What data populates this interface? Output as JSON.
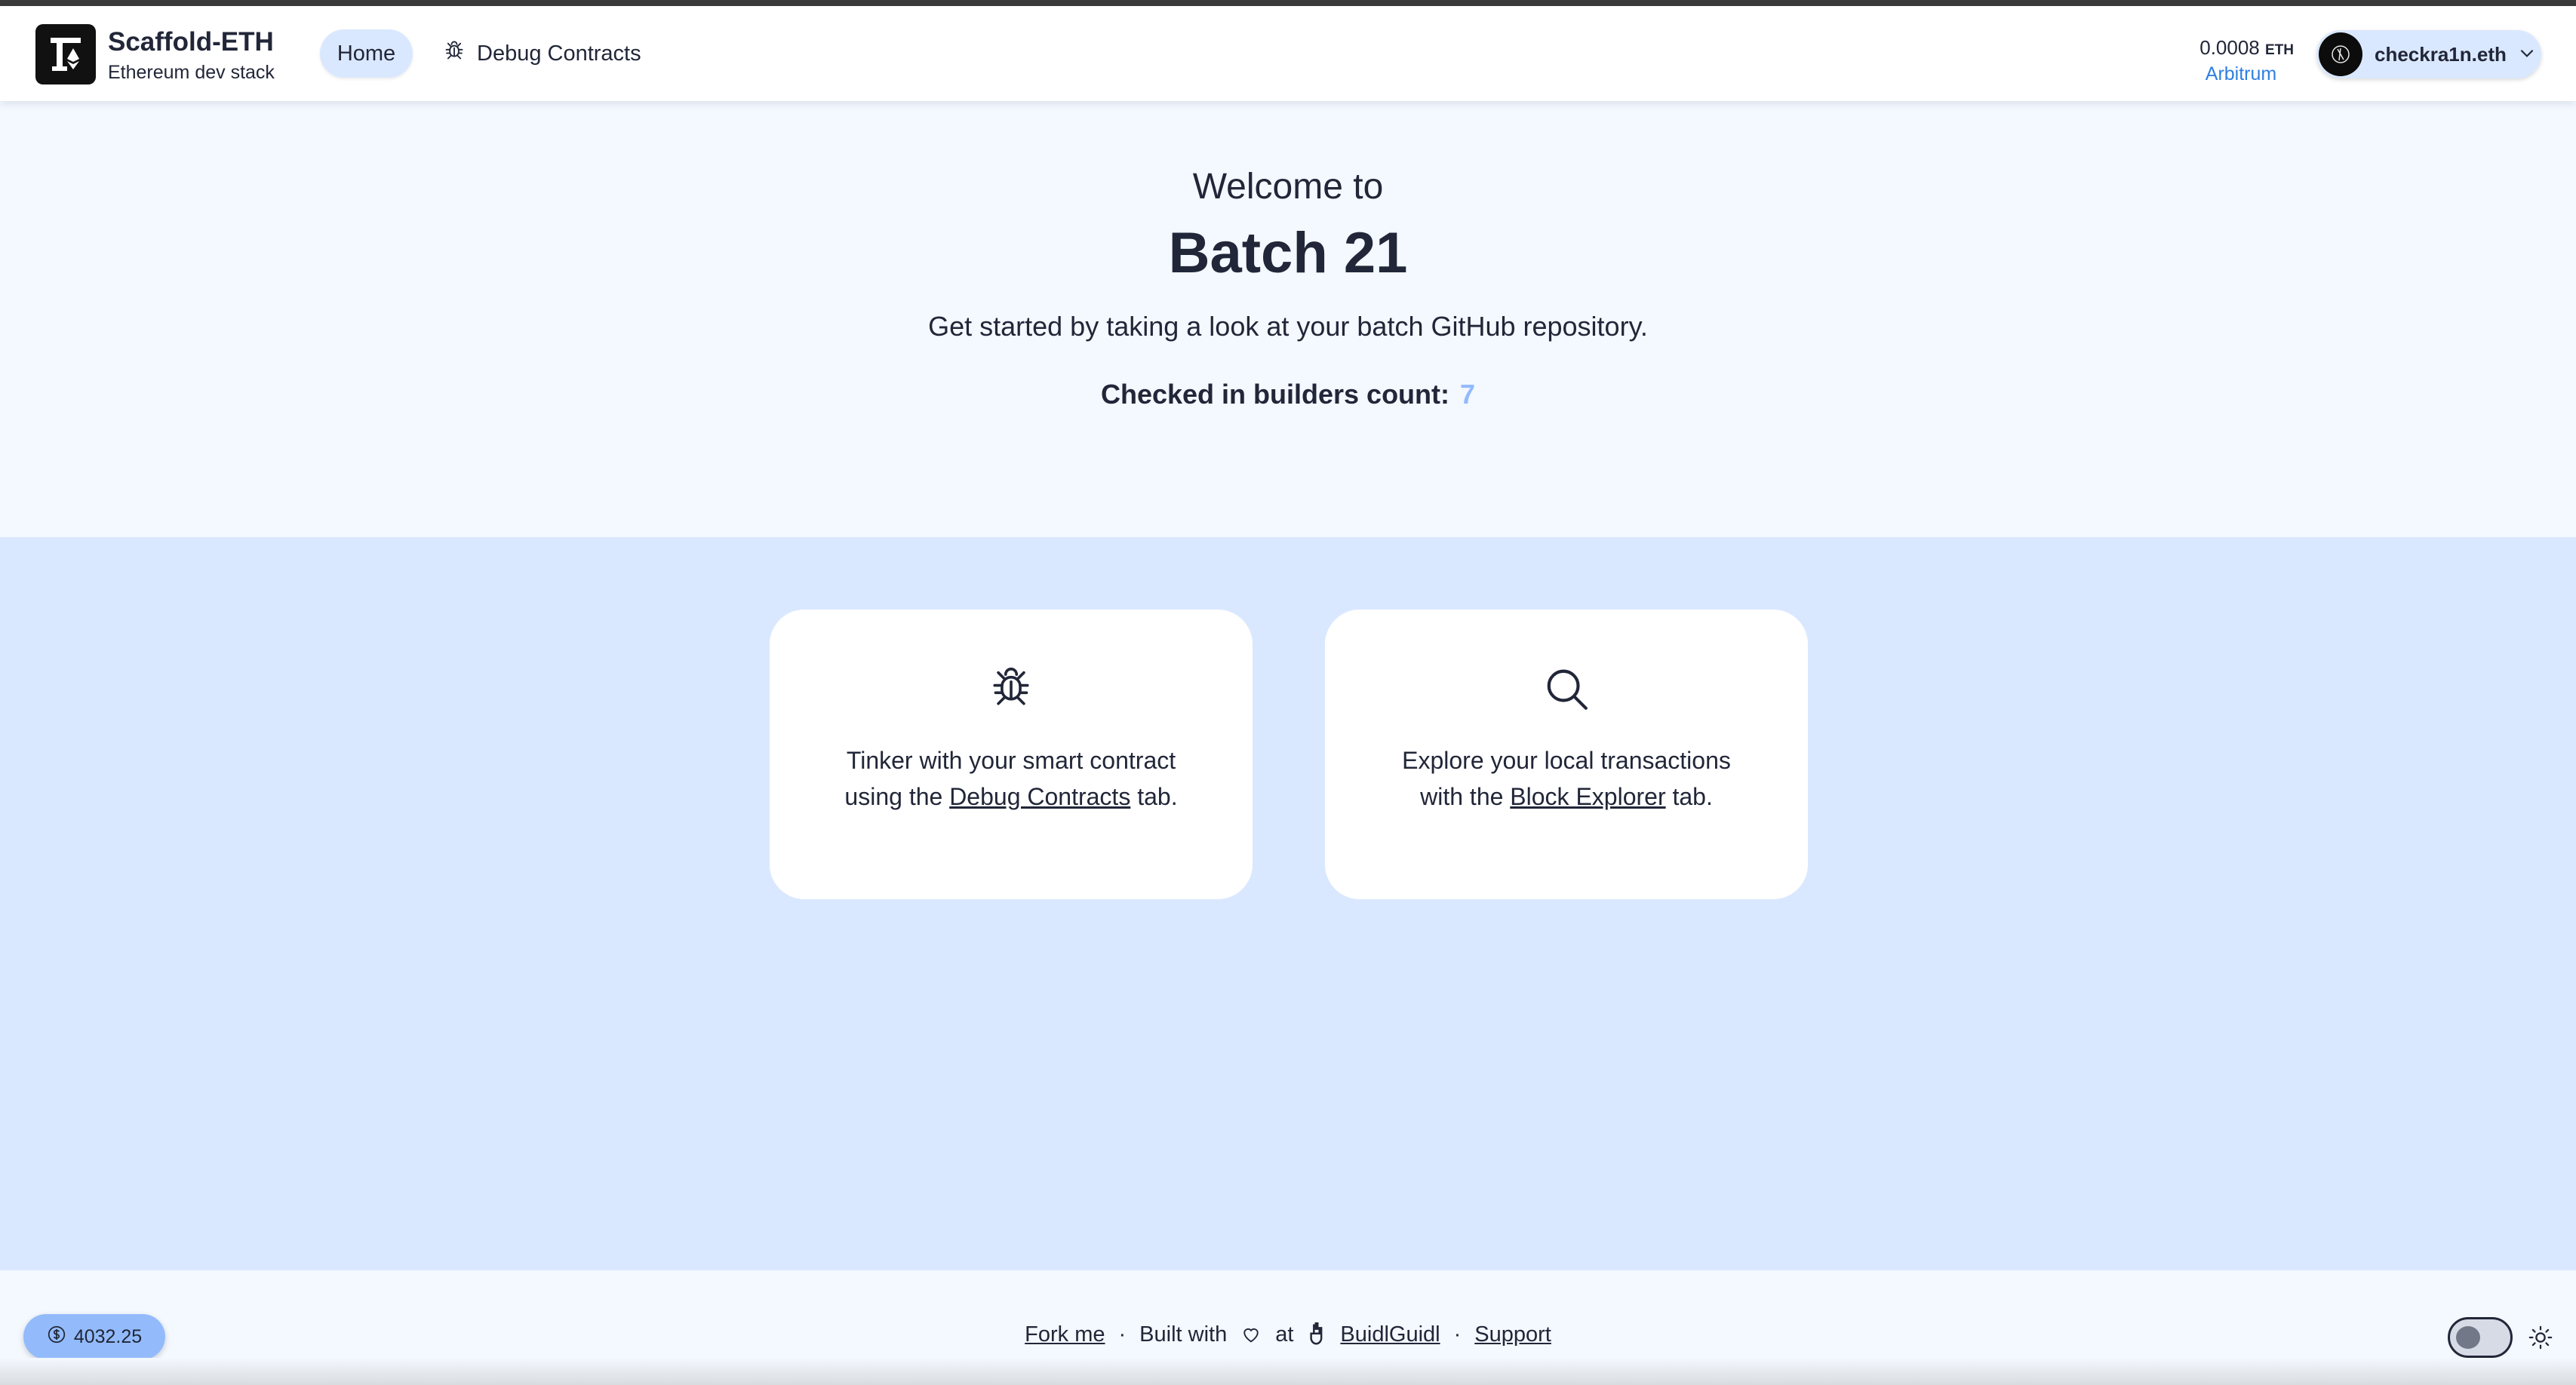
{
  "header": {
    "brand_title": "Scaffold-ETH",
    "brand_subtitle": "Ethereum dev stack",
    "nav": {
      "home": "Home",
      "debug": "Debug Contracts"
    },
    "balance": {
      "amount": "0.0008",
      "unit": "ETH",
      "network": "Arbitrum"
    },
    "account": {
      "name": "checkra1n.eth"
    }
  },
  "hero": {
    "welcome": "Welcome to",
    "title": "Batch 21",
    "description": "Get started by taking a look at your batch GitHub repository.",
    "count_label": "Checked in builders count:",
    "count_value": "7"
  },
  "cards": {
    "debug": {
      "line1": "Tinker with your smart contract",
      "pre": "using the",
      "link": "Debug Contracts",
      "post": "tab."
    },
    "explorer": {
      "line1": "Explore your local transactions",
      "pre": "with the",
      "link": "Block Explorer",
      "post": "tab."
    }
  },
  "footer": {
    "price": "4032.25",
    "fork": "Fork me",
    "sep": "·",
    "built_with": "Built with",
    "at": "at",
    "buidlguidl": "BuidlGuidl",
    "support": "Support"
  },
  "colors": {
    "accent": "#93bbfb",
    "band": "#dae8ff",
    "link_blue": "#2f7fe0",
    "text": "#212638"
  },
  "icons": [
    "logo-icon",
    "bug-icon",
    "search-icon",
    "chevron-down-icon",
    "dollar-icon",
    "heart-icon",
    "buidlguidl-icon",
    "sun-icon"
  ]
}
